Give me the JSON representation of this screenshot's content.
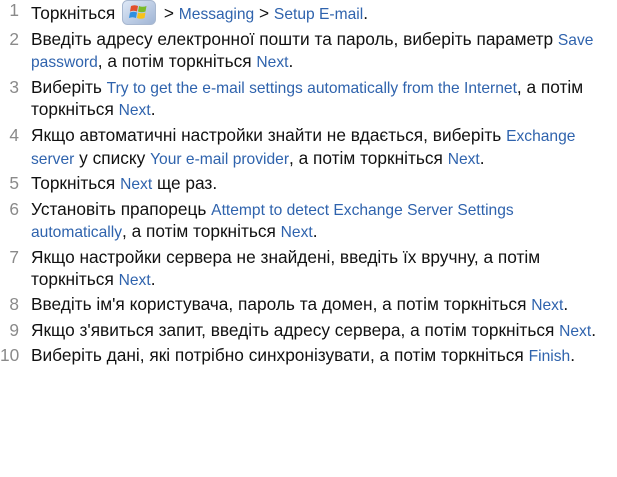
{
  "icons": {
    "start": "windows-start-icon"
  },
  "colors": {
    "text": "#111111",
    "number": "#8a8a8a",
    "link": "#2f63ad"
  },
  "steps": [
    {
      "num": "1",
      "parts": [
        {
          "type": "t",
          "text": "Торкніться "
        },
        {
          "type": "icon",
          "name": "windows-start-icon"
        },
        {
          "type": "t",
          "text": " > "
        },
        {
          "type": "ui",
          "text": "Messaging"
        },
        {
          "type": "t",
          "text": " > "
        },
        {
          "type": "ui",
          "text": "Setup E-mail"
        },
        {
          "type": "t",
          "text": "."
        }
      ]
    },
    {
      "num": "2",
      "parts": [
        {
          "type": "t",
          "text": "Введіть адресу електронної пошти та пароль, виберіть параметр "
        },
        {
          "type": "ui",
          "text": "Save password"
        },
        {
          "type": "t",
          "text": ", а потім торкніться "
        },
        {
          "type": "ui",
          "text": "Next"
        },
        {
          "type": "t",
          "text": "."
        }
      ]
    },
    {
      "num": "3",
      "parts": [
        {
          "type": "t",
          "text": "Виберіть "
        },
        {
          "type": "ui",
          "text": "Try to get the e-mail settings automatically from the Internet"
        },
        {
          "type": "t",
          "text": ", а потім торкніться "
        },
        {
          "type": "ui",
          "text": "Next"
        },
        {
          "type": "t",
          "text": "."
        }
      ]
    },
    {
      "num": "4",
      "parts": [
        {
          "type": "t",
          "text": "Якщо автоматичні настройки знайти не вдається, виберіть "
        },
        {
          "type": "ui",
          "text": "Exchange server"
        },
        {
          "type": "t",
          "text": " у списку "
        },
        {
          "type": "ui",
          "text": "Your e-mail provider"
        },
        {
          "type": "t",
          "text": ", а потім торкніться "
        },
        {
          "type": "ui",
          "text": "Next"
        },
        {
          "type": "t",
          "text": "."
        }
      ]
    },
    {
      "num": "5",
      "parts": [
        {
          "type": "t",
          "text": "Торкніться "
        },
        {
          "type": "ui",
          "text": "Next"
        },
        {
          "type": "t",
          "text": " ще раз."
        }
      ]
    },
    {
      "num": "6",
      "parts": [
        {
          "type": "t",
          "text": "Установіть прапорець "
        },
        {
          "type": "ui",
          "text": "Attempt to detect Exchange Server Settings automatically"
        },
        {
          "type": "t",
          "text": ", а потім торкніться "
        },
        {
          "type": "ui",
          "text": "Next"
        },
        {
          "type": "t",
          "text": "."
        }
      ]
    },
    {
      "num": "7",
      "parts": [
        {
          "type": "t",
          "text": "Якщо настройки сервера не знайдені, введіть їх вручну, а потім торкніться "
        },
        {
          "type": "ui",
          "text": "Next"
        },
        {
          "type": "t",
          "text": "."
        }
      ]
    },
    {
      "num": "8",
      "parts": [
        {
          "type": "t",
          "text": "Введіть ім'я користувача, пароль та домен, а потім торкніться "
        },
        {
          "type": "ui",
          "text": "Next"
        },
        {
          "type": "t",
          "text": "."
        }
      ]
    },
    {
      "num": "9",
      "parts": [
        {
          "type": "t",
          "text": "Якщо з'явиться запит, введіть адресу сервера, а потім торкніться "
        },
        {
          "type": "ui",
          "text": "Next"
        },
        {
          "type": "t",
          "text": "."
        }
      ]
    },
    {
      "num": "10",
      "parts": [
        {
          "type": "t",
          "text": "Виберіть дані, які потрібно синхронізувати, а потім торкніться "
        },
        {
          "type": "ui",
          "text": "Finish"
        },
        {
          "type": "t",
          "text": "."
        }
      ]
    }
  ]
}
